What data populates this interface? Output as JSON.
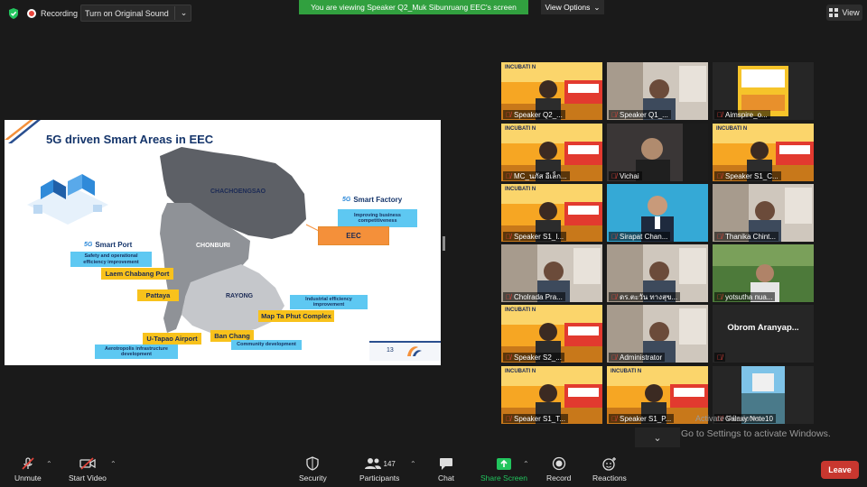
{
  "topbar": {
    "recording_label": "Recording",
    "sound_label": "Turn on Original Sound",
    "viewing_banner": "You are viewing Speaker Q2_Muk Sibunruang EEC's screen",
    "view_options_label": "View Options",
    "view_label": "View"
  },
  "slide": {
    "title": "5G driven Smart Areas in EEC",
    "provinces": [
      "CHACHOENGSAO",
      "CHONBURI",
      "RAYONG"
    ],
    "smart_port": {
      "heading": "Smart Port",
      "desc": "Safety and operational efficiency improvement"
    },
    "smart_factory": {
      "heading": "Smart Factory",
      "desc": "Improving business competitiveness"
    },
    "eec_label": "EEC",
    "laem_chabang": "Laem Chabang Port",
    "pattaya": "Pattaya",
    "map_ta_phut": "Map Ta Phut Complex",
    "industrial_desc": "Industrial efficiency improvement",
    "ban_chang": "Ban Chang",
    "community_desc": "Community development",
    "u_tapao": "U-Tapao Airport",
    "aerotropolis_desc": "Aerotropolis infrastructure development",
    "five_g": "5G",
    "page_number": "13",
    "logo_text": "EEC"
  },
  "gallery": {
    "tiles": [
      {
        "name": "Speaker Q2_...",
        "active": true
      },
      {
        "name": "Speaker Q1_..."
      },
      {
        "name": "Aimspire_o..."
      },
      {
        "name": "MC_นภัส อีเล็ก..."
      },
      {
        "name": "Vichai"
      },
      {
        "name": "Speaker S1_C..."
      },
      {
        "name": "Speaker S1_I..."
      },
      {
        "name": "Sirapat Chan..."
      },
      {
        "name": "Thanika Chint..."
      },
      {
        "name": "Cholrada Pra..."
      },
      {
        "name": "ดร.ตะวัน ทางสุข..."
      },
      {
        "name": "yotsutha nua..."
      },
      {
        "name": "Speaker S2_..."
      },
      {
        "name": "Administrator"
      },
      {
        "name": "Obrom Aranyap..."
      },
      {
        "name": "Speaker S1_T..."
      },
      {
        "name": "Speaker S1_P..."
      },
      {
        "name": "Galaxy Note10"
      }
    ],
    "incubation_text": "INCUBATI   N",
    "watermark_small": "Activate Windows",
    "watermark": "Go to Settings to activate Windows."
  },
  "toolbar": {
    "unmute": "Unmute",
    "start_video": "Start Video",
    "security": "Security",
    "participants": "Participants",
    "participants_count": "147",
    "chat": "Chat",
    "share_screen": "Share Screen",
    "record": "Record",
    "reactions": "Reactions",
    "leave": "Leave"
  },
  "colors": {
    "banner_green": "#31a03f",
    "leave_red": "#c8372f",
    "active_tile": "#f7c51f",
    "share_green": "#22c55e"
  }
}
